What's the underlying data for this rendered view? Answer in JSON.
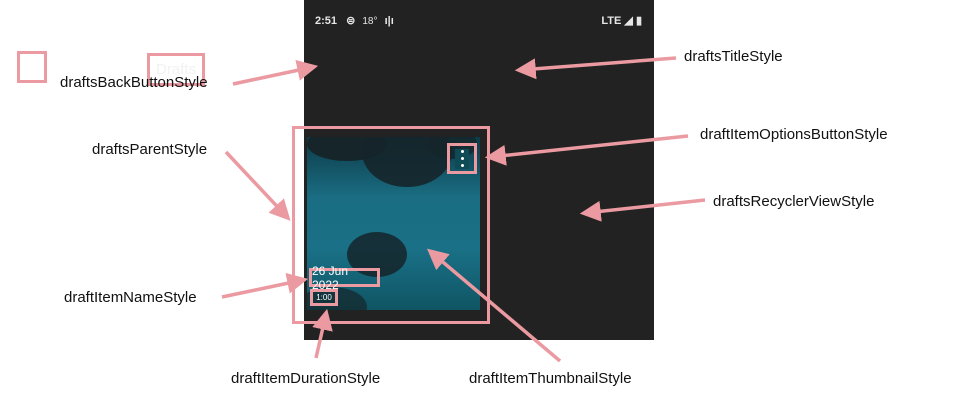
{
  "screen": {
    "status_time": "2:51",
    "status_temp": "18",
    "status_temp_unit": "°",
    "network": "LTE",
    "title": "Drafts",
    "draft_item": {
      "name": "26 Jun 2022",
      "duration": "1:00"
    }
  },
  "callouts": {
    "back_button": "draftsBackButtonStyle",
    "title": "draftsTitleStyle",
    "parent": "draftsParentStyle",
    "options_button": "draftItemOptionsButtonStyle",
    "recycler_view": "draftsRecyclerViewStyle",
    "item_name": "draftItemNameStyle",
    "item_duration": "draftItemDurationStyle",
    "item_thumbnail": "draftItemThumbnailStyle"
  },
  "colors": {
    "highlight": "#ea9aa0",
    "screen_bg": "#222222",
    "thumb_water": "#1a7086"
  }
}
